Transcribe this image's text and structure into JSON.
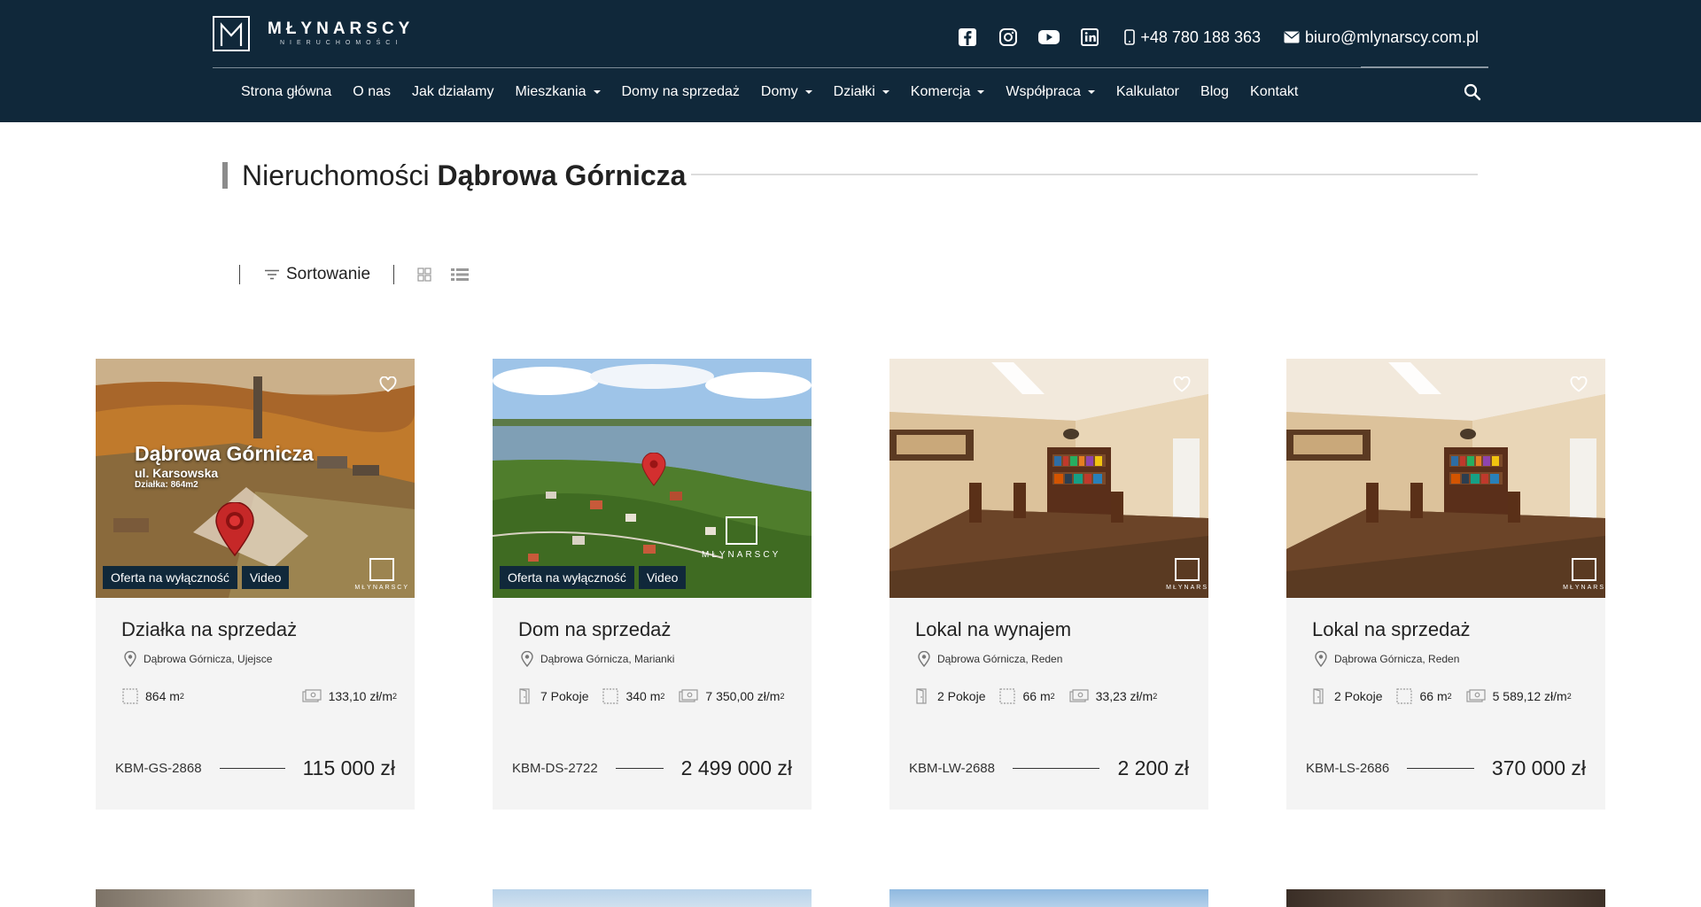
{
  "header": {
    "logo_name": "MŁYNARSCY",
    "logo_sub": "NIERUCHOMOŚCI",
    "phone": "+48 780 188 363",
    "email": "biuro@mlynarscy.com.pl",
    "social_icons": [
      "facebook-icon",
      "instagram-icon",
      "youtube-icon",
      "linkedin-icon"
    ],
    "bg_color": "#10283a"
  },
  "nav": {
    "items": [
      {
        "label": "Strona główna",
        "dropdown": false
      },
      {
        "label": "O nas",
        "dropdown": false
      },
      {
        "label": "Jak działamy",
        "dropdown": false
      },
      {
        "label": "Mieszkania",
        "dropdown": true
      },
      {
        "label": "Domy na sprzedaż",
        "dropdown": false
      },
      {
        "label": "Domy",
        "dropdown": true
      },
      {
        "label": "Działki",
        "dropdown": true
      },
      {
        "label": "Komercja",
        "dropdown": true
      },
      {
        "label": "Współpraca",
        "dropdown": true
      },
      {
        "label": "Kalkulator",
        "dropdown": false
      },
      {
        "label": "Blog",
        "dropdown": false
      },
      {
        "label": "Kontakt",
        "dropdown": false
      }
    ]
  },
  "page": {
    "title_prefix": "Nieruchomości",
    "title_city": "Dąbrowa Górnicza",
    "sort_label": "Sortowanie"
  },
  "listings": [
    {
      "title": "Działka na sprzedaż",
      "location": "Dąbrowa Górnicza, Ujejsce",
      "rooms": null,
      "area": "864 m",
      "price_per_m2": "133,10 zł/m",
      "ref": "KBM-GS-2868",
      "price": "115 000 zł",
      "badges": [
        "Oferta na wyłączność",
        "Video"
      ],
      "image_overlay": {
        "city": "Dąbrowa Górnicza",
        "street": "ul. Karsowska",
        "plot": "Działka: 864m2"
      },
      "watermark": "MŁYNARSCY"
    },
    {
      "title": "Dom na sprzedaż",
      "location": "Dąbrowa Górnicza, Marianki",
      "rooms": "7 Pokoje",
      "area": "340 m",
      "price_per_m2": "7 350,00 zł/m",
      "ref": "KBM-DS-2722",
      "price": "2 499 000 zł",
      "badges": [
        "Oferta na wyłączność",
        "Video"
      ],
      "watermark": "MŁYNARSCY"
    },
    {
      "title": "Lokal na wynajem",
      "location": "Dąbrowa Górnicza, Reden",
      "rooms": "2 Pokoje",
      "area": "66 m",
      "price_per_m2": "33,23 zł/m",
      "ref": "KBM-LW-2688",
      "price": "2 200 zł",
      "badges": [],
      "watermark": "MŁYNARS"
    },
    {
      "title": "Lokal na sprzedaż",
      "location": "Dąbrowa Górnicza, Reden",
      "rooms": "2 Pokoje",
      "area": "66 m",
      "price_per_m2": "5 589,12 zł/m",
      "ref": "KBM-LS-2686",
      "price": "370 000 zł",
      "badges": [],
      "watermark": "MŁYNARS"
    }
  ],
  "sup": "2"
}
